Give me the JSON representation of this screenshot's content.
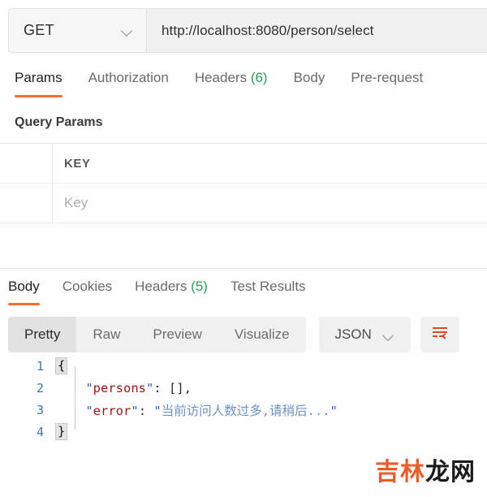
{
  "request_bar": {
    "method": "GET",
    "method_chevron_icon": "chevron-down-icon",
    "url": "http://localhost:8080/person/select"
  },
  "request_tabs": [
    {
      "label": "Params",
      "count": "",
      "active": true
    },
    {
      "label": "Authorization",
      "count": "",
      "active": false
    },
    {
      "label": "Headers",
      "count": "(6)",
      "active": false
    },
    {
      "label": "Body",
      "count": "",
      "active": false
    },
    {
      "label": "Pre-request",
      "count": "",
      "active": false
    }
  ],
  "query_params": {
    "section_title": "Query Params",
    "columns": [
      "KEY"
    ],
    "rows": [
      {
        "key_placeholder": "Key"
      }
    ]
  },
  "response_tabs": [
    {
      "label": "Body",
      "count": "",
      "active": true
    },
    {
      "label": "Cookies",
      "count": "",
      "active": false
    },
    {
      "label": "Headers",
      "count": "(5)",
      "active": false
    },
    {
      "label": "Test Results",
      "count": "",
      "active": false
    }
  ],
  "format_toolbar": {
    "segments": [
      {
        "label": "Pretty",
        "active": true
      },
      {
        "label": "Raw",
        "active": false
      },
      {
        "label": "Preview",
        "active": false
      },
      {
        "label": "Visualize",
        "active": false
      }
    ],
    "language": "JSON",
    "language_chevron_icon": "chevron-down-icon",
    "wrap_icon": "word-wrap-icon"
  },
  "response_body": {
    "language": "json",
    "line_numbers": [
      "1",
      "2",
      "3",
      "4"
    ],
    "lines": [
      {
        "n": "1",
        "open_brace": "{"
      },
      {
        "n": "2",
        "key": "persons",
        "value": "[]",
        "trailing": ","
      },
      {
        "n": "3",
        "key": "error",
        "value": "当前访问人数过多,请稍后..."
      },
      {
        "n": "4",
        "close_brace": "}"
      }
    ],
    "raw": "{\n    \"persons\": [],\n    \"error\": \"当前访问人数过多,请稍后...\"\n}"
  },
  "watermark": {
    "orange_part": "吉林",
    "dark_part": "龙网"
  },
  "colors": {
    "accent": "#ff6c37",
    "count_green": "#1faa55",
    "json_key": "#a31515",
    "json_string": "#6d92c4",
    "line_number": "#3a78b5"
  }
}
